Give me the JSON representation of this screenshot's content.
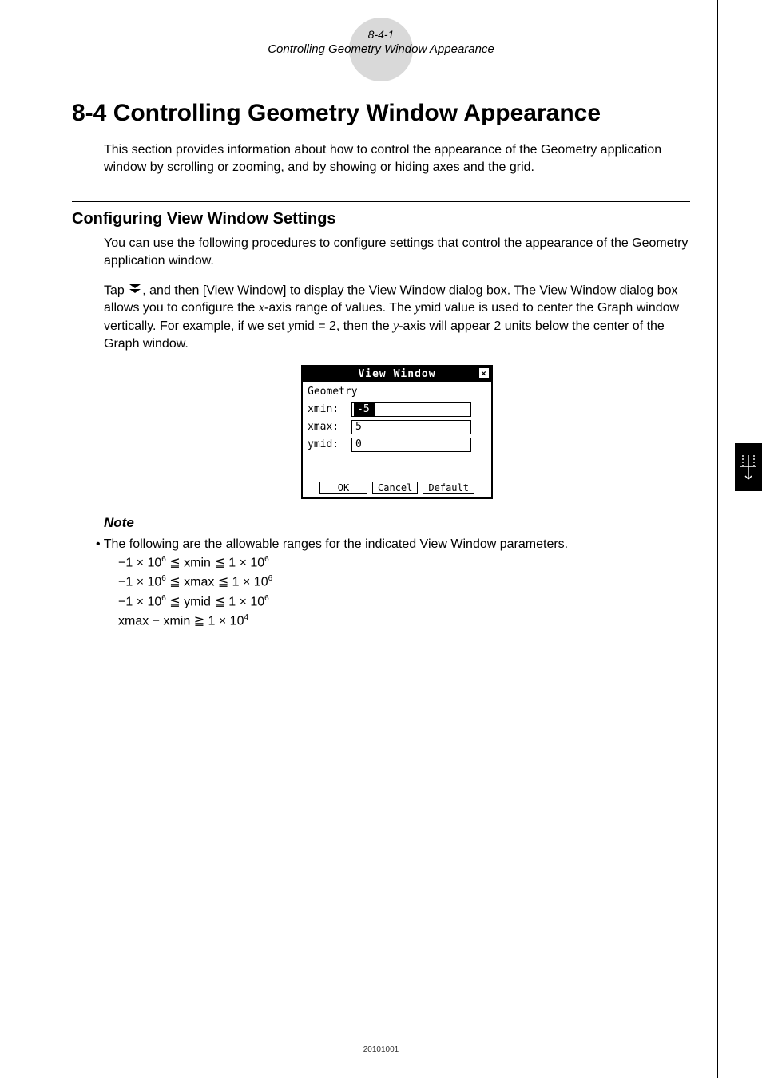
{
  "header": {
    "page_num": "8-4-1",
    "subtitle": "Controlling Geometry Window Appearance"
  },
  "title": "8-4 Controlling Geometry Window Appearance",
  "intro": "This section provides information about how to control the appearance of the Geometry application window by scrolling or zooming, and by showing or hiding axes and the grid.",
  "section": {
    "heading": "Configuring View Window Settings",
    "p1": "You can use the following procedures to configure settings that control the appearance of the Geometry application window.",
    "p2_a": "Tap ",
    "p2_b": ", and then [View Window] to display the View Window dialog box. The View Window dialog box allows you to configure the ",
    "p2_c": "-axis range of values. The ",
    "p2_d": "mid value is used to center the Graph window vertically. For example, if we set ",
    "p2_e": "mid = 2, then the ",
    "p2_f": "-axis will appear 2 units below the center of the Graph window.",
    "x_var": "x",
    "y_var": "y"
  },
  "dialog": {
    "title": "View Window",
    "group": "Geometry",
    "rows": {
      "xmin_label": "xmin:",
      "xmin_value": "-5",
      "xmax_label": "xmax:",
      "xmax_value": "5",
      "ymid_label": "ymid:",
      "ymid_value": "0"
    },
    "buttons": {
      "ok": "OK",
      "cancel": "Cancel",
      "default": "Default"
    }
  },
  "note": {
    "heading": "Note",
    "bullet": "• The following are the allowable ranges for the indicated View Window parameters.",
    "lines": {
      "l1_a": "−1 × 10",
      "l1_b": " ≦ xmin ≦ 1 × 10",
      "l2_a": "−1 × 10",
      "l2_b": " ≦ xmax ≦ 1 × 10",
      "l3_a": "−1 × 10",
      "l3_b": " ≦ ymid ≦ 1 × 10",
      "l4_a": "xmax − xmin ≧ 1 × 10",
      "exp6": "6",
      "exp4": "4"
    }
  },
  "footer_code": "20101001"
}
